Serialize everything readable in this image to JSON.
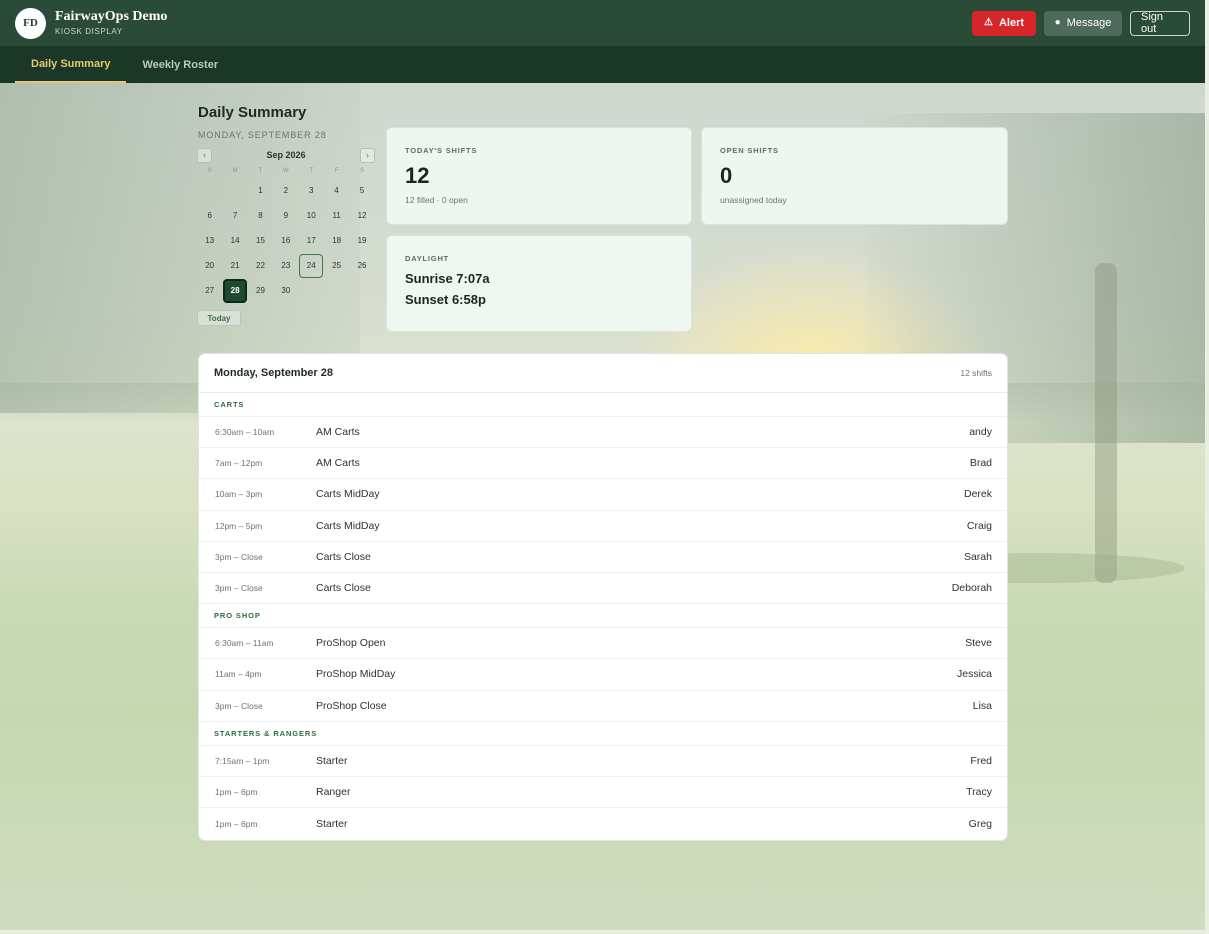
{
  "app": {
    "initials": "FD",
    "title": "FairwayOps Demo",
    "subtitle": "KIOSK DISPLAY"
  },
  "actions": {
    "alert_label": "Alert",
    "alert_icon": "siren-icon",
    "message_label": "Message",
    "message_icon": "speech-bubble-icon",
    "signout_label": "Sign out"
  },
  "tabs": [
    {
      "label": "Daily Summary",
      "active": true
    },
    {
      "label": "Weekly Roster",
      "active": false
    }
  ],
  "summary": {
    "title": "Daily Summary",
    "date_label": "MONDAY, SEPTEMBER 28"
  },
  "calendar": {
    "month": "Sep 2026",
    "prev": "‹",
    "next": "›",
    "dow": [
      "S",
      "M",
      "T",
      "W",
      "T",
      "F",
      "S"
    ],
    "leading_blanks": 2,
    "days": [
      "1",
      "2",
      "3",
      "4",
      "5",
      "6",
      "7",
      "8",
      "9",
      "10",
      "11",
      "12",
      "13",
      "14",
      "15",
      "16",
      "17",
      "18",
      "19",
      "20",
      "21",
      "22",
      "23",
      "24",
      "25",
      "26",
      "27",
      "28",
      "29",
      "30"
    ],
    "today": "24",
    "selected": "28",
    "today_button": "Today"
  },
  "stats": {
    "todays_shifts": {
      "label": "TODAY'S SHIFTS",
      "value": "12",
      "sub": "12 filled · 0 open"
    },
    "open_shifts": {
      "label": "OPEN SHIFTS",
      "value": "0",
      "sub": "unassigned today"
    },
    "daylight": {
      "label": "DAYLIGHT",
      "sunrise": "Sunrise 7:07a",
      "sunset": "Sunset 6:58p"
    }
  },
  "schedule": {
    "title": "Monday, September 28",
    "count": "12 shifts",
    "groups": [
      {
        "label": "CARTS",
        "rows": [
          {
            "time": "6:30am – 10am",
            "role": "AM Carts",
            "who": "andy"
          },
          {
            "time": "7am – 12pm",
            "role": "AM Carts",
            "who": "Brad"
          },
          {
            "time": "10am – 3pm",
            "role": "Carts MidDay",
            "who": "Derek"
          },
          {
            "time": "12pm – 5pm",
            "role": "Carts MidDay",
            "who": "Craig"
          },
          {
            "time": "3pm – Close",
            "role": "Carts Close",
            "who": "Sarah"
          },
          {
            "time": "3pm – Close",
            "role": "Carts Close",
            "who": "Deborah"
          }
        ]
      },
      {
        "label": "PRO SHOP",
        "rows": [
          {
            "time": "6:30am – 11am",
            "role": "ProShop Open",
            "who": "Steve"
          },
          {
            "time": "11am – 4pm",
            "role": "ProShop MidDay",
            "who": "Jessica"
          },
          {
            "time": "3pm – Close",
            "role": "ProShop Close",
            "who": "Lisa"
          }
        ]
      },
      {
        "label": "STARTERS & RANGERS",
        "rows": [
          {
            "time": "7:15am – 1pm",
            "role": "Starter",
            "who": "Fred"
          },
          {
            "time": "1pm – 6pm",
            "role": "Ranger",
            "who": "Tracy"
          },
          {
            "time": "1pm – 6pm",
            "role": "Starter",
            "who": "Greg"
          }
        ]
      }
    ]
  },
  "colors": {
    "header": "#2a4b38",
    "tabbar": "#1b3727",
    "accent_tab": "#e8c86f",
    "alert": "#d7262b",
    "group_label": "#2f6b43"
  }
}
